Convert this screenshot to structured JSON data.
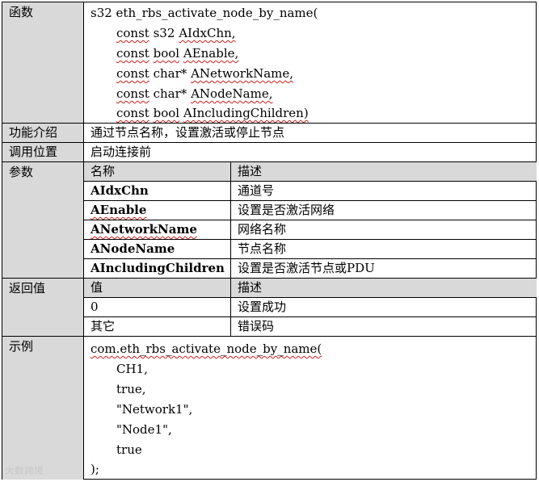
{
  "rows": {
    "func": {
      "label": "函数",
      "sig_line": "s32 eth_rbs_activate_node_by_name(",
      "params": [
        {
          "kw": "const",
          "type": "s32",
          "name": "AIdxChn,"
        },
        {
          "kw": "const",
          "type": "bool",
          "name": "AEnable,"
        },
        {
          "kw": "const",
          "type": "char*",
          "name": "ANetworkName,"
        },
        {
          "kw": "const",
          "type": "char*",
          "name": "ANodeName,"
        },
        {
          "kw": "const",
          "type": "bool",
          "name": "AIncludingChildren)"
        }
      ]
    },
    "intro": {
      "label": "功能介绍",
      "value": "通过节点名称，设置激活或停止节点"
    },
    "position": {
      "label": "调用位置",
      "value": "启动连接前"
    },
    "args": {
      "label": "参数",
      "header": [
        "名称",
        "描述"
      ],
      "items": [
        {
          "name": "AIdxChn",
          "desc": "通道号"
        },
        {
          "name": "AEnable",
          "desc": "设置是否激活网络"
        },
        {
          "name": "ANetworkName",
          "desc": "网络名称"
        },
        {
          "name": "ANodeName",
          "desc": "节点名称"
        },
        {
          "name": "AIncludingChildren",
          "desc": "设置是否激活节点或PDU"
        }
      ]
    },
    "ret": {
      "label": "返回值",
      "header": [
        "值",
        "描述"
      ],
      "items": [
        {
          "value": "0",
          "desc": "设置成功"
        },
        {
          "value": "其它",
          "desc": "错误码"
        }
      ]
    },
    "example": {
      "label": "示例",
      "lines": [
        "com.eth_rbs_activate_node_by_name(",
        "CH1,",
        "true,",
        "\"Network1\",",
        "\"Node1\",",
        "true",
        ");"
      ]
    }
  },
  "watermark": "大数跨境"
}
